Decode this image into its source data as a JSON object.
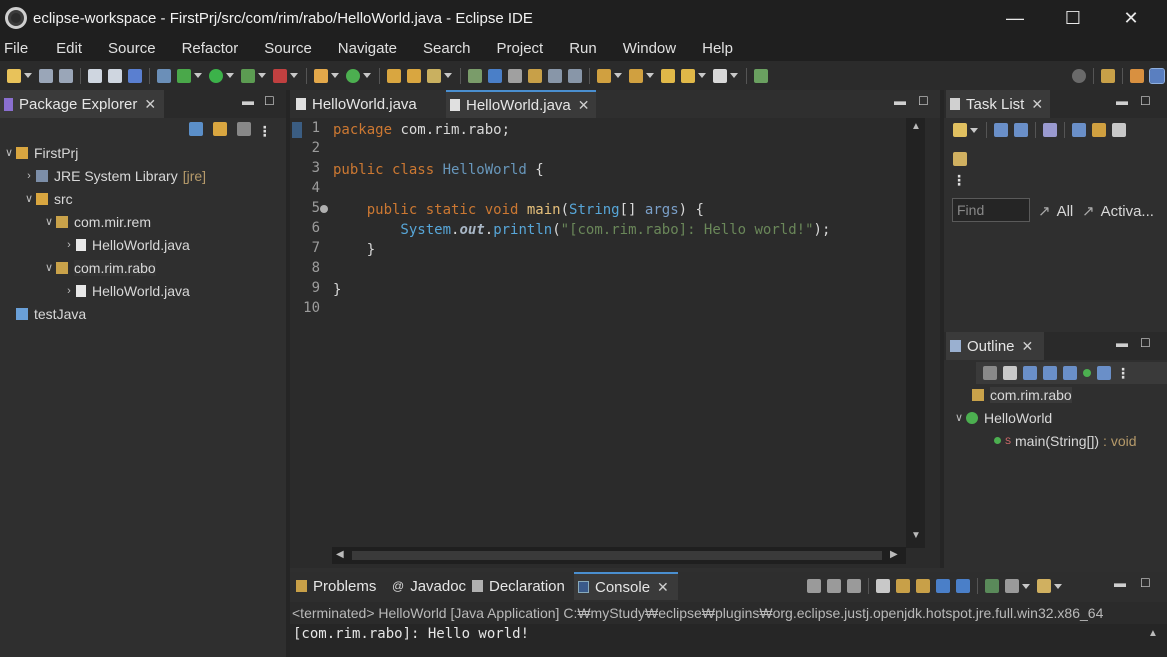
{
  "window": {
    "title": "eclipse-workspace - FirstPrj/src/com/rim/rabo/HelloWorld.java - Eclipse IDE",
    "minimize": "—",
    "maximize": "☐",
    "close": "✕"
  },
  "menu": [
    "File",
    "Edit",
    "Source",
    "Refactor",
    "Source",
    "Navigate",
    "Search",
    "Project",
    "Run",
    "Window",
    "Help"
  ],
  "package_explorer": {
    "tab_label": "Package Explorer",
    "tree": [
      {
        "label": "FirstPrj",
        "expanded": true
      },
      {
        "label": "JRE System Library",
        "suffix": "[jre]"
      },
      {
        "label": "src"
      },
      {
        "label": "com.mir.rem"
      },
      {
        "label": "HelloWorld.java"
      },
      {
        "label": "com.rim.rabo"
      },
      {
        "label": "HelloWorld.java"
      },
      {
        "label": "testJava"
      }
    ]
  },
  "editor": {
    "tabs": [
      {
        "label": "HelloWorld.java",
        "active": false
      },
      {
        "label": "HelloWorld.java",
        "active": true
      }
    ],
    "line_numbers": [
      "1",
      "2",
      "3",
      "4",
      "5",
      "6",
      "7",
      "8",
      "9",
      "10"
    ],
    "code": {
      "l1_kw": "package",
      "l1_rest": " com.rim.rabo;",
      "l3_kw": "public class ",
      "l3_cls": "HelloWorld",
      "l3_rest": " {",
      "l5_kw": "    public static void ",
      "l5_m": "main",
      "l5_p1": "(",
      "l5_t": "String",
      "l5_p2": "[] ",
      "l5_a": "args",
      "l5_p3": ") {",
      "l6_sys": "        System",
      "l6_dot1": ".",
      "l6_out": "out",
      "l6_dot2": ".",
      "l6_pr": "println",
      "l6_o": "(",
      "l6_str": "\"[com.rim.rabo]: Hello world!\"",
      "l6_c": ");",
      "l7": "    }",
      "l9": "}"
    }
  },
  "task_list": {
    "tab_label": "Task List",
    "find_placeholder": "Find",
    "all_label": "All",
    "activate_label": "Activa..."
  },
  "outline": {
    "tab_label": "Outline",
    "items": [
      "com.rim.rabo",
      "HelloWorld",
      "main(String[])",
      ": void"
    ]
  },
  "console": {
    "tabs": [
      "Problems",
      "Javadoc",
      "Declaration",
      "Console"
    ],
    "status": "<terminated> HelloWorld [Java Application] C:₩myStudy₩eclipse₩plugins₩org.eclipse.justj.openjdk.hotspot.jre.full.win32.x86_64",
    "output": "[com.rim.rabo]: Hello world!"
  }
}
